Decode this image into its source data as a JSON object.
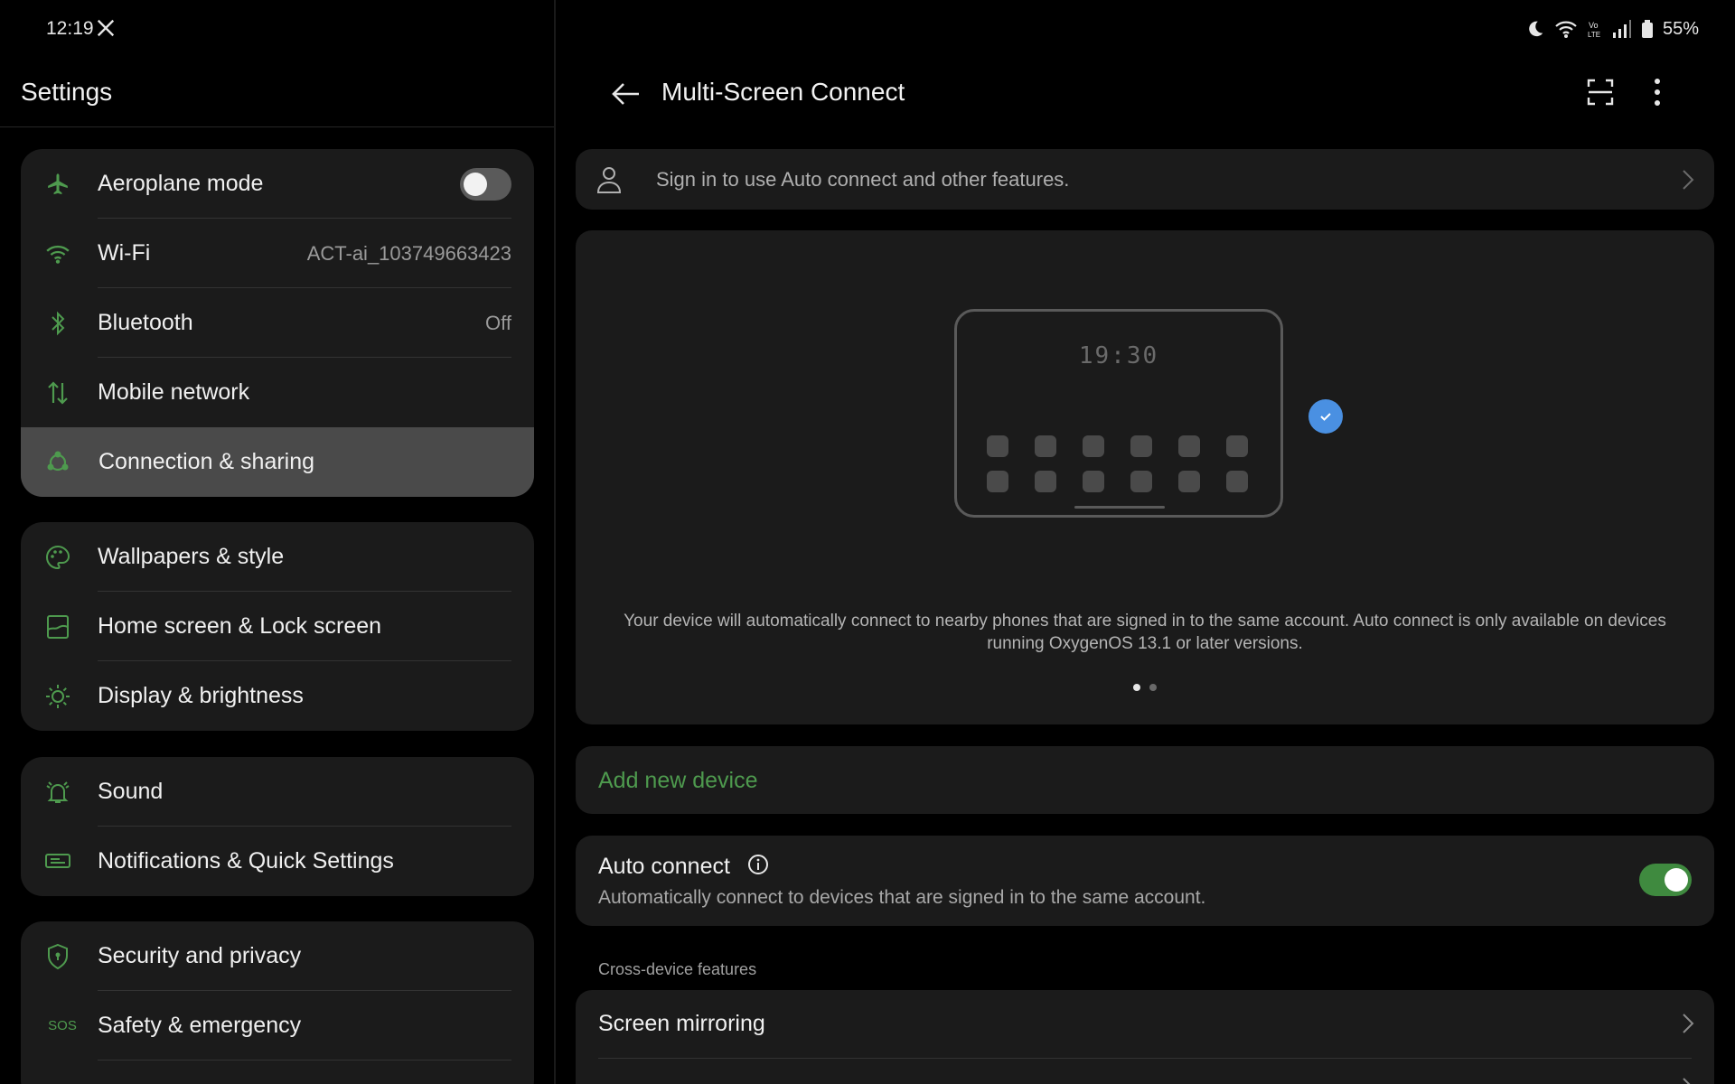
{
  "status_bar": {
    "time": "12:19",
    "battery": "55%",
    "icons": [
      "x-logo-icon",
      "moon-icon",
      "wifi-icon",
      "volte-icon",
      "signal-icon",
      "battery-icon"
    ]
  },
  "left": {
    "title": "Settings",
    "groups": [
      {
        "items": [
          {
            "label": "Aeroplane mode",
            "icon": "airplane-icon",
            "toggle": false
          },
          {
            "label": "Wi-Fi",
            "icon": "wifi-icon",
            "value": "ACT-ai_103749663423"
          },
          {
            "label": "Bluetooth",
            "icon": "bluetooth-icon",
            "value": "Off"
          },
          {
            "label": "Mobile network",
            "icon": "mobile-data-icon"
          },
          {
            "label": "Connection & sharing",
            "icon": "connection-sharing-icon",
            "selected": true
          }
        ]
      },
      {
        "items": [
          {
            "label": "Wallpapers & style",
            "icon": "palette-icon"
          },
          {
            "label": "Home screen & Lock screen",
            "icon": "home-screen-icon"
          },
          {
            "label": "Display & brightness",
            "icon": "brightness-icon"
          }
        ]
      },
      {
        "items": [
          {
            "label": "Sound",
            "icon": "bell-icon"
          },
          {
            "label": "Notifications & Quick Settings",
            "icon": "notifications-icon"
          }
        ]
      },
      {
        "items": [
          {
            "label": "Security and privacy",
            "icon": "shield-icon"
          },
          {
            "label": "Safety & emergency",
            "icon": "sos-icon",
            "icon_text": "SOS"
          }
        ]
      }
    ]
  },
  "right": {
    "title": "Multi-Screen Connect",
    "signin_text": "Sign in to use Auto connect and other features.",
    "hero": {
      "clock": "19:30",
      "description": "Your device will automatically connect to nearby phones that are signed in to the same account. Auto connect is only available on devices running OxygenOS 13.1 or later versions.",
      "page_count": 2,
      "active_page": 1
    },
    "add_device": "Add new device",
    "auto_connect": {
      "title": "Auto connect",
      "subtitle": "Automatically connect to devices that are signed in to the same account.",
      "enabled": true
    },
    "section_label": "Cross-device features",
    "features": [
      "Screen mirroring"
    ]
  },
  "colors": {
    "accent_green": "#4e9a4e",
    "toggle_on": "#3f8a3f",
    "check_blue": "#4a90e2",
    "card_bg": "#1b1b1b",
    "selected_bg": "#4a4a4a"
  }
}
